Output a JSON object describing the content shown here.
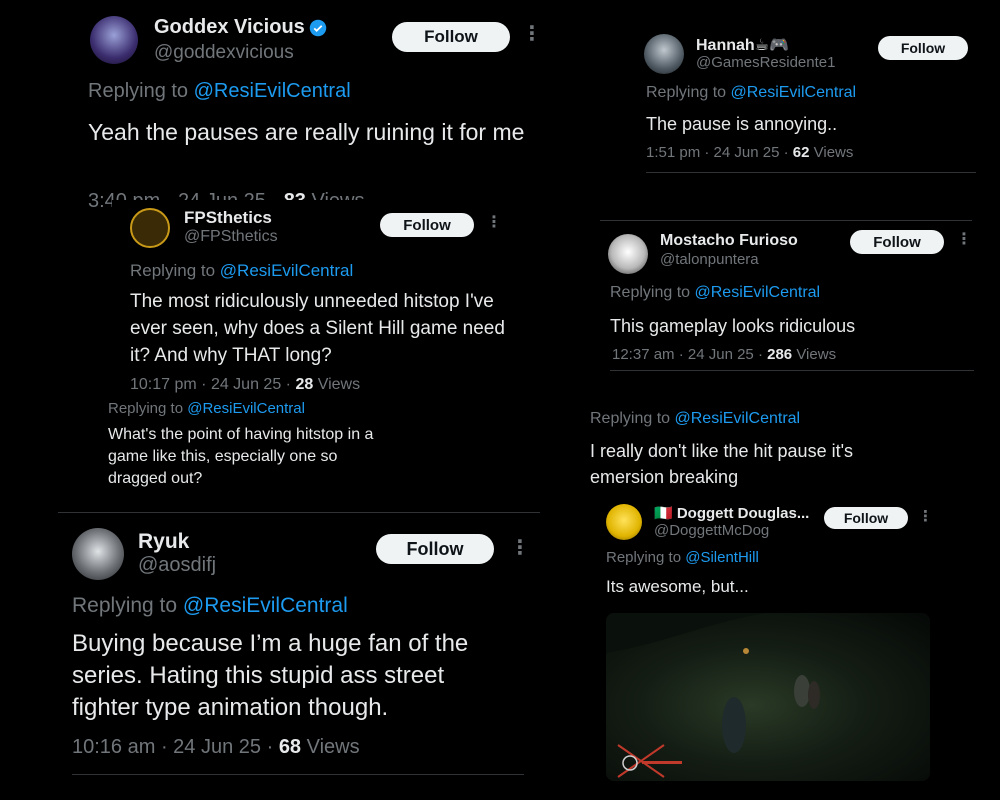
{
  "reply_prefix": "Replying to",
  "follow_label": "Follow",
  "more_glyph": "⋮",
  "sep": " · ",
  "views_label": "Views",
  "colors": {
    "background": "#000000",
    "text": "#e7e9ea",
    "muted": "#71767b",
    "link": "#1d9bf0",
    "verified": "#1d9bf0",
    "button_bg": "#eff3f4"
  },
  "goddex": {
    "name": "Goddex Vicious",
    "handle": "@goddexvicious",
    "reply_to": "@ResiEvilCentral",
    "text": "Yeah the pauses are really ruining it for me",
    "time": "3:40 pm",
    "date": "24 Jun 25",
    "views": "83",
    "verified": true
  },
  "fps": {
    "name": "FPSthetics",
    "handle": "@FPSthetics",
    "reply_to": "@ResiEvilCentral",
    "text": "The most ridiculously unneeded hitstop I've ever seen, why does a Silent Hill game need it? And why THAT long?",
    "time": "10:17 pm",
    "date": "24 Jun 25",
    "views": "28"
  },
  "anon": {
    "reply_to": "@ResiEvilCentral",
    "text": "What's the point of having hitstop in a game like this, especially one so dragged out?"
  },
  "ryuk": {
    "name": "Ryuk",
    "handle": "@aosdifj",
    "reply_to": "@ResiEvilCentral",
    "text": "Buying because I’m a huge fan of the series. Hating this stupid ass street fighter type animation though.",
    "time": "10:16 am",
    "date": "24 Jun 25",
    "views": "68"
  },
  "hannah": {
    "name": "Hannah☕🎮",
    "handle": "@GamesResidente1",
    "reply_to": "@ResiEvilCentral",
    "text": "The pause is annoying..",
    "time": "1:51 pm",
    "date": "24 Jun 25",
    "views": "62"
  },
  "mostacho": {
    "name": "Mostacho Furioso",
    "handle": "@talonpuntera",
    "reply_to": "@ResiEvilCentral",
    "text": "This gameplay looks ridiculous",
    "time": "12:37 am",
    "date": "24 Jun 25",
    "views": "286"
  },
  "anon2": {
    "reply_to": "@ResiEvilCentral",
    "text": "I really don't like the hit pause it's emersion breaking"
  },
  "doggett": {
    "name": "🇮🇹 Doggett Douglas...",
    "handle": "@DoggettMcDog",
    "reply_to": "@SilentHill",
    "text": "Its awesome, but..."
  }
}
